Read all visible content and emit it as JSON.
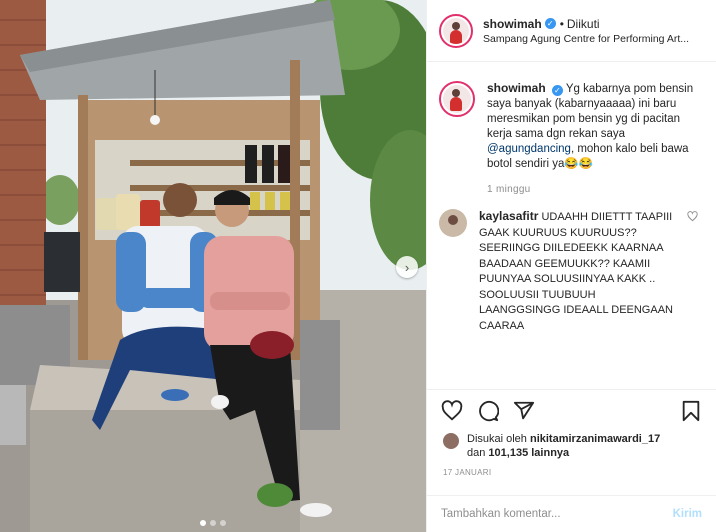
{
  "header": {
    "username": "showimah",
    "separator": "•",
    "follow_status": "Diikuti",
    "location": "Sampang Agung Centre for Performing Art..."
  },
  "caption": {
    "username": "showimah",
    "text_before_mention": "Yg kabarnya pom bensin saya banyak (kabarnyaaaaa) ini baru meresmikan pom bensin yg di pacitan kerja sama dgn rekan saya",
    "mention": "@agungdancing",
    "text_after_mention": ", mohon kalo beli bawa botol sendiri ya😂😂",
    "time": "1 minggu"
  },
  "comments": [
    {
      "username": "kaylasafitr",
      "text": "UDAAHH DIIETTT TAAPIII GAAK KUURUUS KUURUUS?? SEERIINGG DIILEDEEKK KAARNAA BAADAAN GEEMUUKK?? KAAMII PUUNYAA SOLUUSIINYAA KAKK .. SOOLUUSII TUUBUUH LAANGGSINGG IDEAALL DEENGAAN CAARAA"
    }
  ],
  "likes": {
    "prefix": "Disukai oleh",
    "user": "nikitamirzanimawardi_17",
    "middle": "dan",
    "count": "101,135",
    "suffix": "lainnya"
  },
  "post_date": "17 JANUARI",
  "add_comment": {
    "placeholder": "Tambahkan komentar...",
    "post_label": "Kirim"
  },
  "icons": {
    "like": "heart-icon",
    "comment": "comment-icon",
    "share": "share-icon",
    "save": "bookmark-icon",
    "carousel_next": "chevron-right-icon",
    "verified": "verified-badge-icon"
  },
  "carousel": {
    "slide_count": 3,
    "active_index": 0
  },
  "colors": {
    "verified_blue": "#3897f0",
    "link_blue": "#00376b",
    "post_button_disabled": "#b2dffc",
    "story_ring": "#e1306c"
  }
}
